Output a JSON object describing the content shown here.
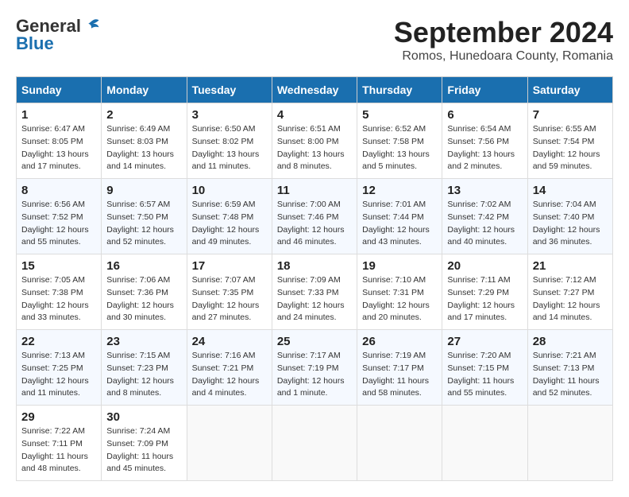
{
  "header": {
    "logo_line1": "General",
    "logo_line2": "Blue",
    "month_title": "September 2024",
    "location": "Romos, Hunedoara County, Romania"
  },
  "columns": [
    "Sunday",
    "Monday",
    "Tuesday",
    "Wednesday",
    "Thursday",
    "Friday",
    "Saturday"
  ],
  "weeks": [
    [
      {
        "day": "1",
        "sunrise": "6:47 AM",
        "sunset": "8:05 PM",
        "daylight": "13 hours and 17 minutes."
      },
      {
        "day": "2",
        "sunrise": "6:49 AM",
        "sunset": "8:03 PM",
        "daylight": "13 hours and 14 minutes."
      },
      {
        "day": "3",
        "sunrise": "6:50 AM",
        "sunset": "8:02 PM",
        "daylight": "13 hours and 11 minutes."
      },
      {
        "day": "4",
        "sunrise": "6:51 AM",
        "sunset": "8:00 PM",
        "daylight": "13 hours and 8 minutes."
      },
      {
        "day": "5",
        "sunrise": "6:52 AM",
        "sunset": "7:58 PM",
        "daylight": "13 hours and 5 minutes."
      },
      {
        "day": "6",
        "sunrise": "6:54 AM",
        "sunset": "7:56 PM",
        "daylight": "13 hours and 2 minutes."
      },
      {
        "day": "7",
        "sunrise": "6:55 AM",
        "sunset": "7:54 PM",
        "daylight": "12 hours and 59 minutes."
      }
    ],
    [
      {
        "day": "8",
        "sunrise": "6:56 AM",
        "sunset": "7:52 PM",
        "daylight": "12 hours and 55 minutes."
      },
      {
        "day": "9",
        "sunrise": "6:57 AM",
        "sunset": "7:50 PM",
        "daylight": "12 hours and 52 minutes."
      },
      {
        "day": "10",
        "sunrise": "6:59 AM",
        "sunset": "7:48 PM",
        "daylight": "12 hours and 49 minutes."
      },
      {
        "day": "11",
        "sunrise": "7:00 AM",
        "sunset": "7:46 PM",
        "daylight": "12 hours and 46 minutes."
      },
      {
        "day": "12",
        "sunrise": "7:01 AM",
        "sunset": "7:44 PM",
        "daylight": "12 hours and 43 minutes."
      },
      {
        "day": "13",
        "sunrise": "7:02 AM",
        "sunset": "7:42 PM",
        "daylight": "12 hours and 40 minutes."
      },
      {
        "day": "14",
        "sunrise": "7:04 AM",
        "sunset": "7:40 PM",
        "daylight": "12 hours and 36 minutes."
      }
    ],
    [
      {
        "day": "15",
        "sunrise": "7:05 AM",
        "sunset": "7:38 PM",
        "daylight": "12 hours and 33 minutes."
      },
      {
        "day": "16",
        "sunrise": "7:06 AM",
        "sunset": "7:36 PM",
        "daylight": "12 hours and 30 minutes."
      },
      {
        "day": "17",
        "sunrise": "7:07 AM",
        "sunset": "7:35 PM",
        "daylight": "12 hours and 27 minutes."
      },
      {
        "day": "18",
        "sunrise": "7:09 AM",
        "sunset": "7:33 PM",
        "daylight": "12 hours and 24 minutes."
      },
      {
        "day": "19",
        "sunrise": "7:10 AM",
        "sunset": "7:31 PM",
        "daylight": "12 hours and 20 minutes."
      },
      {
        "day": "20",
        "sunrise": "7:11 AM",
        "sunset": "7:29 PM",
        "daylight": "12 hours and 17 minutes."
      },
      {
        "day": "21",
        "sunrise": "7:12 AM",
        "sunset": "7:27 PM",
        "daylight": "12 hours and 14 minutes."
      }
    ],
    [
      {
        "day": "22",
        "sunrise": "7:13 AM",
        "sunset": "7:25 PM",
        "daylight": "12 hours and 11 minutes."
      },
      {
        "day": "23",
        "sunrise": "7:15 AM",
        "sunset": "7:23 PM",
        "daylight": "12 hours and 8 minutes."
      },
      {
        "day": "24",
        "sunrise": "7:16 AM",
        "sunset": "7:21 PM",
        "daylight": "12 hours and 4 minutes."
      },
      {
        "day": "25",
        "sunrise": "7:17 AM",
        "sunset": "7:19 PM",
        "daylight": "12 hours and 1 minute."
      },
      {
        "day": "26",
        "sunrise": "7:19 AM",
        "sunset": "7:17 PM",
        "daylight": "11 hours and 58 minutes."
      },
      {
        "day": "27",
        "sunrise": "7:20 AM",
        "sunset": "7:15 PM",
        "daylight": "11 hours and 55 minutes."
      },
      {
        "day": "28",
        "sunrise": "7:21 AM",
        "sunset": "7:13 PM",
        "daylight": "11 hours and 52 minutes."
      }
    ],
    [
      {
        "day": "29",
        "sunrise": "7:22 AM",
        "sunset": "7:11 PM",
        "daylight": "11 hours and 48 minutes."
      },
      {
        "day": "30",
        "sunrise": "7:24 AM",
        "sunset": "7:09 PM",
        "daylight": "11 hours and 45 minutes."
      },
      null,
      null,
      null,
      null,
      null
    ]
  ]
}
